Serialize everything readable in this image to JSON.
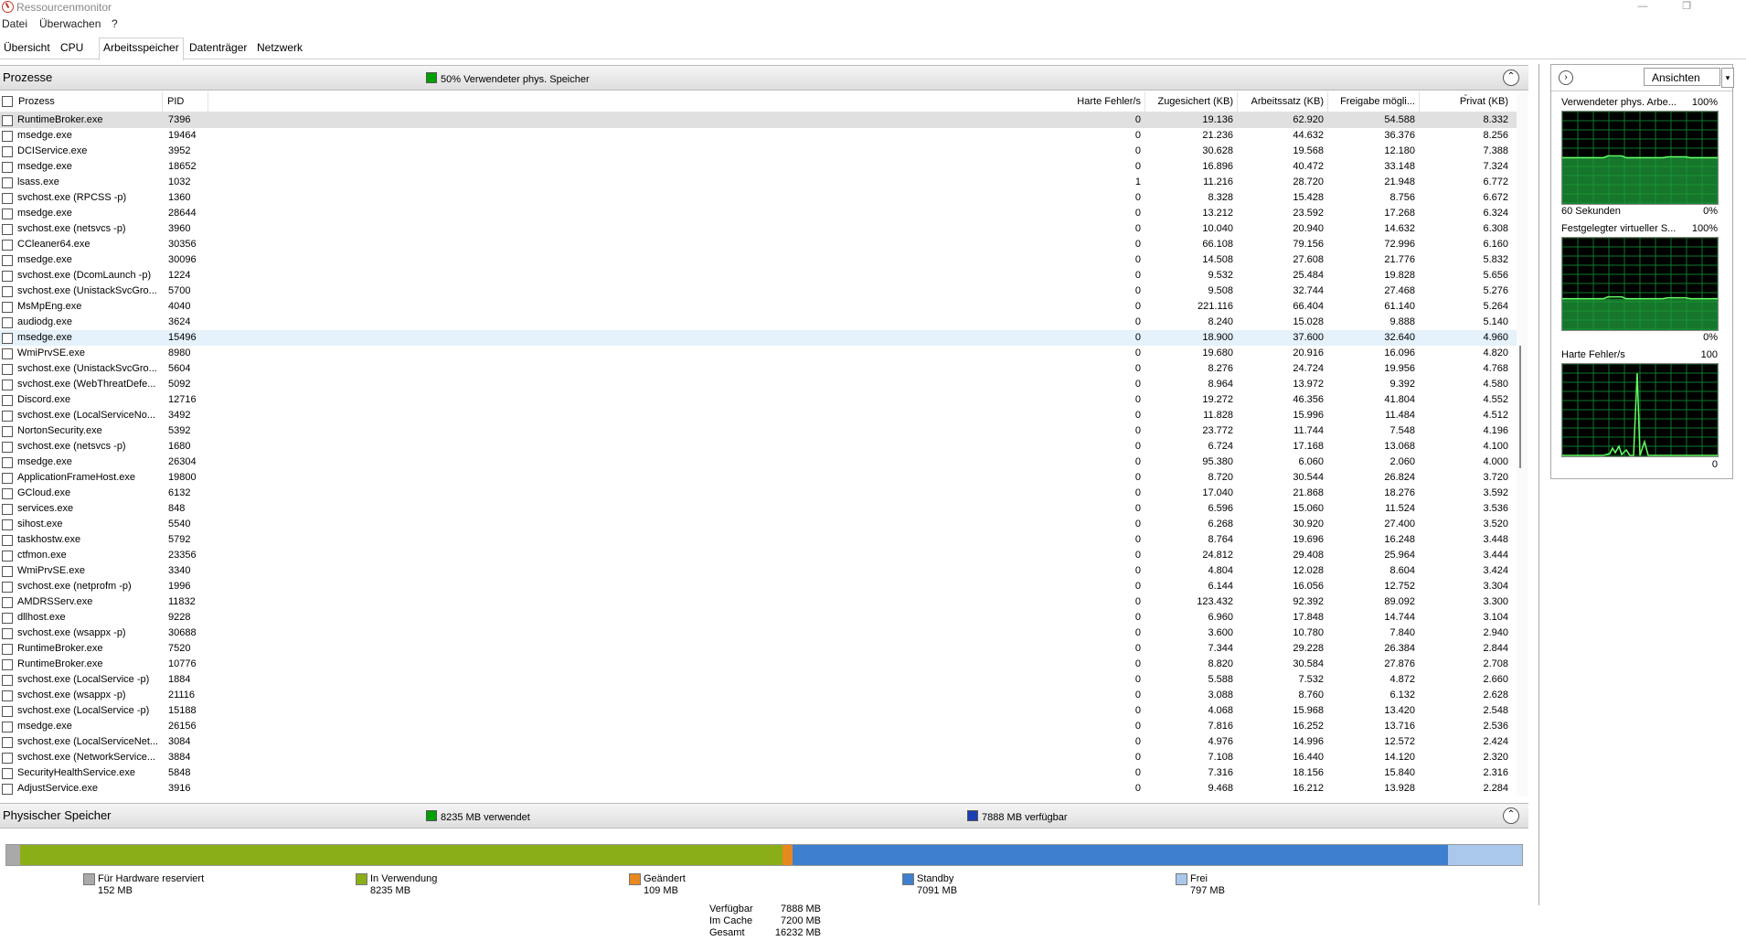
{
  "window": {
    "title": "Ressourcenmonitor",
    "minimize": "—",
    "restore": "❐"
  },
  "menu": [
    "Datei",
    "Überwachen",
    "?"
  ],
  "tabs": [
    {
      "label": "Übersicht",
      "active": false
    },
    {
      "label": "CPU",
      "active": false
    },
    {
      "label": "Arbeitsspeicher",
      "active": true
    },
    {
      "label": "Datenträger",
      "active": false
    },
    {
      "label": "Netzwerk",
      "active": false
    }
  ],
  "processes": {
    "title": "Prozesse",
    "status": "50% Verwendeter phys. Speicher",
    "status_color": "#00a000",
    "collapse_icon": "⌃",
    "columns": [
      "Prozess",
      "PID",
      "Harte Fehler/s",
      "Zugesichert (KB)",
      "Arbeitssatz (KB)",
      "Freigabe mögli...",
      "Privat (KB)"
    ],
    "rows": [
      [
        "RuntimeBroker.exe",
        "7396",
        "0",
        "19.136",
        "62.920",
        "54.588",
        "8.332"
      ],
      [
        "msedge.exe",
        "19464",
        "0",
        "21.236",
        "44.632",
        "36.376",
        "8.256"
      ],
      [
        "DCIService.exe",
        "3952",
        "0",
        "30.628",
        "19.568",
        "12.180",
        "7.388"
      ],
      [
        "msedge.exe",
        "18652",
        "0",
        "16.896",
        "40.472",
        "33.148",
        "7.324"
      ],
      [
        "lsass.exe",
        "1032",
        "1",
        "11.216",
        "28.720",
        "21.948",
        "6.772"
      ],
      [
        "svchost.exe (RPCSS -p)",
        "1360",
        "0",
        "8.328",
        "15.428",
        "8.756",
        "6.672"
      ],
      [
        "msedge.exe",
        "28644",
        "0",
        "13.212",
        "23.592",
        "17.268",
        "6.324"
      ],
      [
        "svchost.exe (netsvcs -p)",
        "3960",
        "0",
        "10.040",
        "20.940",
        "14.632",
        "6.308"
      ],
      [
        "CCleaner64.exe",
        "30356",
        "0",
        "66.108",
        "79.156",
        "72.996",
        "6.160"
      ],
      [
        "msedge.exe",
        "30096",
        "0",
        "14.508",
        "27.608",
        "21.776",
        "5.832"
      ],
      [
        "svchost.exe (DcomLaunch -p)",
        "1224",
        "0",
        "9.532",
        "25.484",
        "19.828",
        "5.656"
      ],
      [
        "svchost.exe (UnistackSvcGro...",
        "5700",
        "0",
        "9.508",
        "32.744",
        "27.468",
        "5.276"
      ],
      [
        "MsMpEng.exe",
        "4040",
        "0",
        "221.116",
        "66.404",
        "61.140",
        "5.264"
      ],
      [
        "audiodg.exe",
        "3624",
        "0",
        "8.240",
        "15.028",
        "9.888",
        "5.140"
      ],
      [
        "msedge.exe",
        "15496",
        "0",
        "18.900",
        "37.600",
        "32.640",
        "4.960"
      ],
      [
        "WmiPrvSE.exe",
        "8980",
        "0",
        "19.680",
        "20.916",
        "16.096",
        "4.820"
      ],
      [
        "svchost.exe (UnistackSvcGro...",
        "5604",
        "0",
        "8.276",
        "24.724",
        "19.956",
        "4.768"
      ],
      [
        "svchost.exe (WebThreatDefe...",
        "5092",
        "0",
        "8.964",
        "13.972",
        "9.392",
        "4.580"
      ],
      [
        "Discord.exe",
        "12716",
        "0",
        "19.272",
        "46.356",
        "41.804",
        "4.552"
      ],
      [
        "svchost.exe (LocalServiceNo...",
        "3492",
        "0",
        "11.828",
        "15.996",
        "11.484",
        "4.512"
      ],
      [
        "NortonSecurity.exe",
        "5392",
        "0",
        "23.772",
        "11.744",
        "7.548",
        "4.196"
      ],
      [
        "svchost.exe (netsvcs -p)",
        "1680",
        "0",
        "6.724",
        "17.168",
        "13.068",
        "4.100"
      ],
      [
        "msedge.exe",
        "26304",
        "0",
        "95.380",
        "6.060",
        "2.060",
        "4.000"
      ],
      [
        "ApplicationFrameHost.exe",
        "19800",
        "0",
        "8.720",
        "30.544",
        "26.824",
        "3.720"
      ],
      [
        "GCloud.exe",
        "6132",
        "0",
        "17.040",
        "21.868",
        "18.276",
        "3.592"
      ],
      [
        "services.exe",
        "848",
        "0",
        "6.596",
        "15.060",
        "11.524",
        "3.536"
      ],
      [
        "sihost.exe",
        "5540",
        "0",
        "6.268",
        "30.920",
        "27.400",
        "3.520"
      ],
      [
        "taskhostw.exe",
        "5792",
        "0",
        "8.764",
        "19.696",
        "16.248",
        "3.448"
      ],
      [
        "ctfmon.exe",
        "23356",
        "0",
        "24.812",
        "29.408",
        "25.964",
        "3.444"
      ],
      [
        "WmiPrvSE.exe",
        "3340",
        "0",
        "4.804",
        "12.028",
        "8.604",
        "3.424"
      ],
      [
        "svchost.exe (netprofm -p)",
        "1996",
        "0",
        "6.144",
        "16.056",
        "12.752",
        "3.304"
      ],
      [
        "AMDRSServ.exe",
        "11832",
        "0",
        "123.432",
        "92.392",
        "89.092",
        "3.300"
      ],
      [
        "dllhost.exe",
        "9228",
        "0",
        "6.960",
        "17.848",
        "14.744",
        "3.104"
      ],
      [
        "svchost.exe (wsappx -p)",
        "30688",
        "0",
        "3.600",
        "10.780",
        "7.840",
        "2.940"
      ],
      [
        "RuntimeBroker.exe",
        "7520",
        "0",
        "7.344",
        "29.228",
        "26.384",
        "2.844"
      ],
      [
        "RuntimeBroker.exe",
        "10776",
        "0",
        "8.820",
        "30.584",
        "27.876",
        "2.708"
      ],
      [
        "svchost.exe (LocalService -p)",
        "1884",
        "0",
        "5.588",
        "7.532",
        "4.872",
        "2.660"
      ],
      [
        "svchost.exe (wsappx -p)",
        "21116",
        "0",
        "3.088",
        "8.760",
        "6.132",
        "2.628"
      ],
      [
        "svchost.exe (LocalService -p)",
        "15188",
        "0",
        "4.068",
        "15.968",
        "13.420",
        "2.548"
      ],
      [
        "msedge.exe",
        "26156",
        "0",
        "7.816",
        "16.252",
        "13.716",
        "2.536"
      ],
      [
        "svchost.exe (LocalServiceNet...",
        "3084",
        "0",
        "4.976",
        "14.996",
        "12.572",
        "2.424"
      ],
      [
        "svchost.exe (NetworkService...",
        "3884",
        "0",
        "7.108",
        "16.440",
        "14.120",
        "2.320"
      ],
      [
        "SecurityHealthService.exe",
        "5848",
        "0",
        "7.316",
        "18.156",
        "15.840",
        "2.316"
      ],
      [
        "AdjustService.exe",
        "3916",
        "0",
        "9.468",
        "16.212",
        "13.928",
        "2.284"
      ]
    ]
  },
  "physical": {
    "title": "Physischer Speicher",
    "used_status": "8235 MB verwendet",
    "free_status": "7888 MB verfügbar",
    "used_color": "#00a000",
    "free_color": "#1a3fb5",
    "segments": [
      {
        "label": "Für Hardware reserviert",
        "value": "152 MB",
        "mb": 152,
        "color": "#a9a9a9"
      },
      {
        "label": "In Verwendung",
        "value": "8235 MB",
        "mb": 8235,
        "color": "#8aae17"
      },
      {
        "label": "Geändert",
        "value": "109 MB",
        "mb": 109,
        "color": "#e6891e"
      },
      {
        "label": "Standby",
        "value": "7091 MB",
        "mb": 7091,
        "color": "#3f7fcf"
      },
      {
        "label": "Frei",
        "value": "797 MB",
        "mb": 797,
        "color": "#aac8ec"
      }
    ],
    "summary": [
      {
        "key": "Verfügbar",
        "value": "7888 MB"
      },
      {
        "key": "Im Cache",
        "value": "7200 MB"
      },
      {
        "key": "Gesamt",
        "value": "16232 MB"
      }
    ]
  },
  "right_panel": {
    "expand_icon": "›",
    "views_label": "Ansichten",
    "views_dropdown_icon": "▾",
    "graphs": [
      {
        "title": "Verwendeter phys. Arbe...",
        "max": "100%",
        "footer_left": "60 Sekunden",
        "footer_right": "0%",
        "level_pct": 50
      },
      {
        "title": "Festgelegter virtueller S...",
        "max": "100%",
        "footer_left": "",
        "footer_right": "0%",
        "level_pct": 34
      },
      {
        "title": "Harte Fehler/s",
        "max": "100",
        "footer_left": "",
        "footer_right": "0",
        "level_pct": 0
      }
    ]
  }
}
